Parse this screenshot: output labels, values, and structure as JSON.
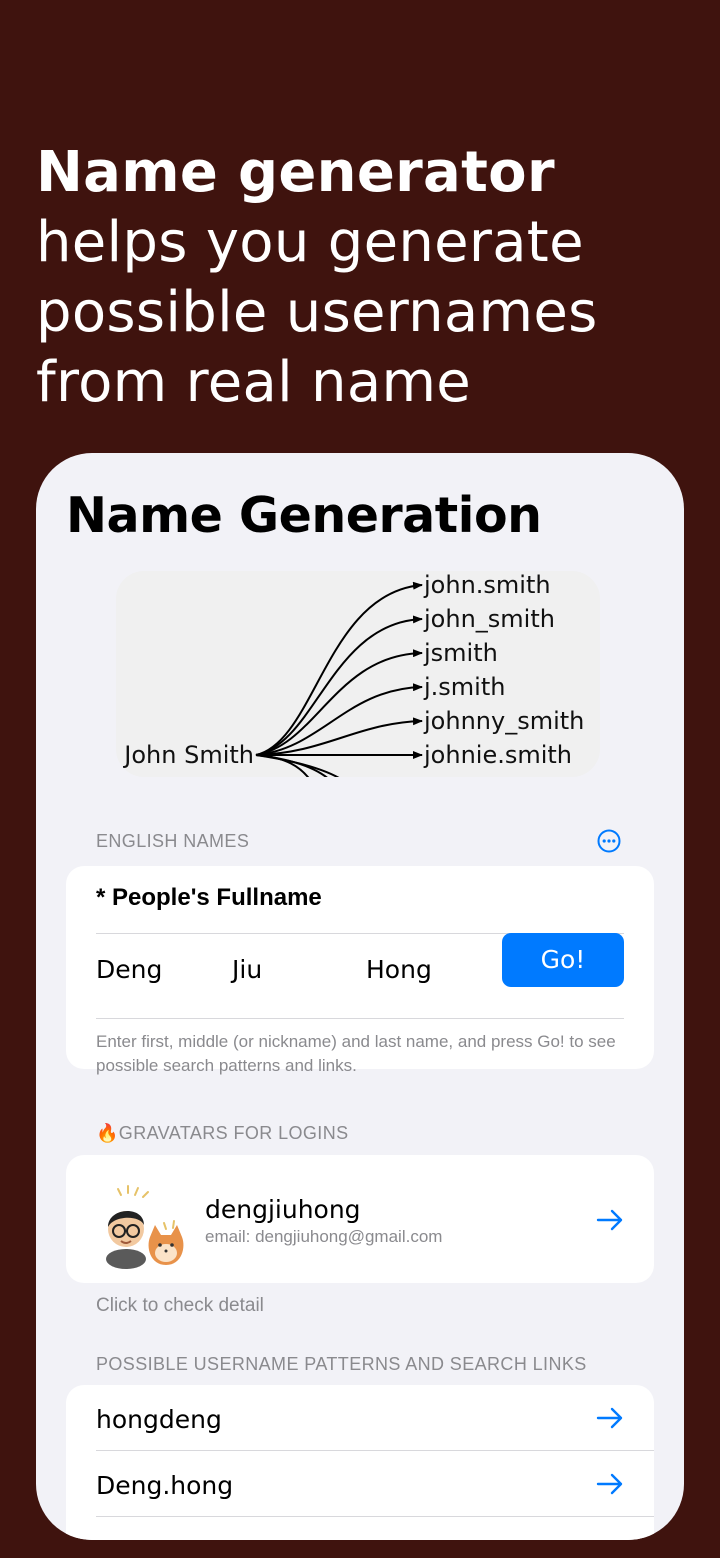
{
  "headline": {
    "bold": "Name generator",
    "rest": " helps you generate possible usernames from  real name"
  },
  "screen": {
    "title": "Name Generation",
    "diagram": {
      "source": "John Smith",
      "targets": [
        "john.smith",
        "john_smith",
        "jsmith",
        "j.smith",
        "johnny_smith",
        "johnie.smith"
      ]
    },
    "english_names": {
      "header": "ENGLISH NAMES",
      "more_icon": "ellipsis-circle-icon",
      "required_label": "* People's Fullname",
      "first": "Deng",
      "middle": "Jiu",
      "last": "Hong",
      "go_label": "Go!",
      "hint": "Enter first, middle (or nickname) and last name, and press Go! to see possible search patterns and links."
    },
    "gravatars": {
      "header": "🔥GRAVATARS FOR LOGINS",
      "name": "dengjiuhong",
      "email": "email: dengjiuhong@gmail.com",
      "note": "Click to check detail"
    },
    "patterns": {
      "header": "POSSIBLE USERNAME PATTERNS AND SEARCH LINKS",
      "items": [
        "hongdeng",
        "Deng.hong"
      ]
    }
  },
  "colors": {
    "background": "#3f130e",
    "accent": "#007aff",
    "screen_bg": "#f2f2f7"
  }
}
